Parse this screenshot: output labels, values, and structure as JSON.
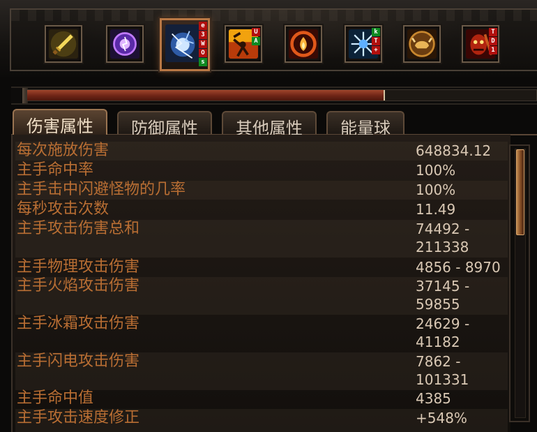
{
  "skills": [
    {
      "icon": "sword-icon",
      "hotkeys": []
    },
    {
      "icon": "arcane-orb-icon",
      "hotkeys": []
    },
    {
      "icon": "lightning-orb-icon",
      "hotkeys": [
        {
          "t": "e",
          "c": "red"
        },
        {
          "t": "3",
          "c": "red"
        },
        {
          "t": "W",
          "c": "red"
        },
        {
          "t": "O",
          "c": "red"
        },
        {
          "t": "s",
          "c": "green"
        }
      ],
      "active": true
    },
    {
      "icon": "hammer-strike-icon",
      "hotkeys": [
        {
          "t": "U",
          "c": "red"
        },
        {
          "t": "A",
          "c": "green"
        }
      ]
    },
    {
      "icon": "fire-ring-icon",
      "hotkeys": []
    },
    {
      "icon": "frost-star-icon",
      "hotkeys": [
        {
          "t": "k",
          "c": "green"
        },
        {
          "t": "T",
          "c": "red"
        },
        {
          "t": "+",
          "c": "red"
        }
      ]
    },
    {
      "icon": "bull-charge-icon",
      "hotkeys": []
    },
    {
      "icon": "demon-face-icon",
      "hotkeys": [
        {
          "t": "T",
          "c": "red"
        },
        {
          "t": "D",
          "c": "red"
        },
        {
          "t": "1",
          "c": "red"
        }
      ]
    }
  ],
  "progress": 0.7,
  "tabs": {
    "damage": "伤害属性",
    "defense": "防御属性",
    "other": "其他属性",
    "orb": "能量球"
  },
  "stats": [
    {
      "label": "每次施放伤害",
      "value": "648834.12"
    },
    {
      "label": "主手命中率",
      "value": "100%"
    },
    {
      "label": "主手击中闪避怪物的几率",
      "value": "100%"
    },
    {
      "label": "每秒攻击次数",
      "value": "11.49"
    },
    {
      "label": "主手攻击伤害总和",
      "value": "74492 -",
      "value2": "211338"
    },
    {
      "label": "主手物理攻击伤害",
      "value": "4856 - 8970"
    },
    {
      "label": "主手火焰攻击伤害",
      "value": "37145 -",
      "value2": "59855"
    },
    {
      "label": "主手冰霜攻击伤害",
      "value": "24629 -",
      "value2": "41182"
    },
    {
      "label": "主手闪电攻击伤害",
      "value": "7862 -",
      "value2": "101331"
    },
    {
      "label": "主手命中值",
      "value": "4385"
    },
    {
      "label": "主手攻击速度修正",
      "value": "+548%"
    }
  ],
  "scroll_position": 0.0,
  "scroll_visible_fraction": 0.32
}
